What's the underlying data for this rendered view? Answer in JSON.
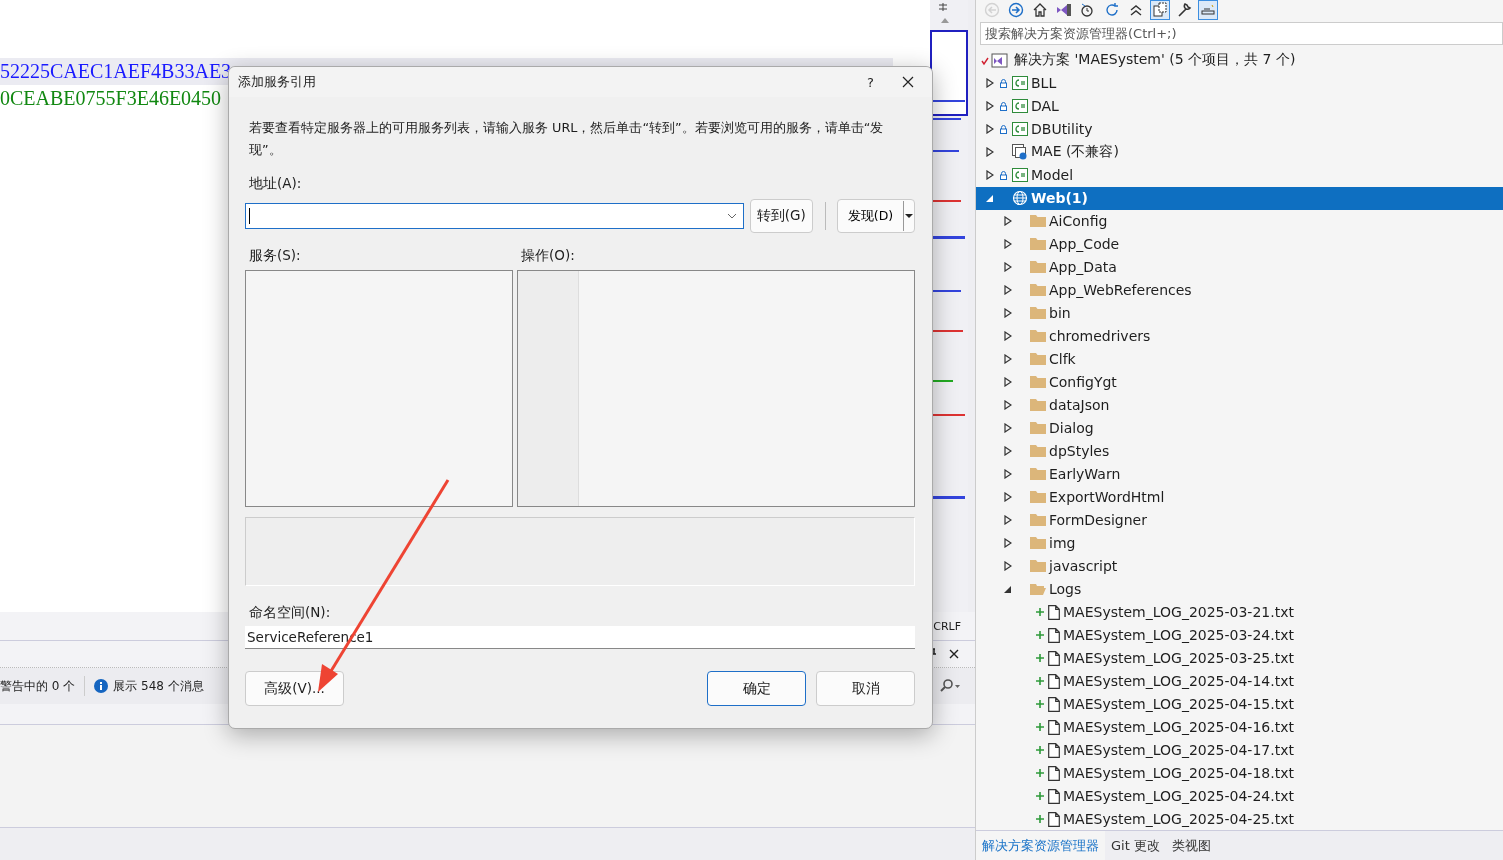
{
  "editor": {
    "code_lines": [
      {
        "text": "52225CAEC1AEF4B33AE3",
        "color": "#1a1aff"
      },
      {
        "text": "0CEABE0755F3E46E0450",
        "color": "#118811"
      }
    ],
    "line_ending": "CRLF"
  },
  "output_panel": {
    "warnings": "警告中的 0 个",
    "messages": "展示 548 个消息"
  },
  "dialog": {
    "title": "添加服务引用",
    "help": "?",
    "description": "若要查看特定服务器上的可用服务列表，请输入服务 URL，然后单击“转到”。若要浏览可用的服务，请单击“发现”。",
    "address_label": "地址(A):",
    "go_button": "转到(G)",
    "discover_button": "发现(D)",
    "services_label": "服务(S):",
    "operations_label": "操作(O):",
    "namespace_label": "命名空间(N):",
    "namespace_value": "ServiceReference1",
    "advanced_button": "高级(V)...",
    "ok_button": "确定",
    "cancel_button": "取消"
  },
  "solution_explorer": {
    "toolbar": [
      {
        "kind": "back",
        "on": false,
        "disabled": true
      },
      {
        "kind": "forward",
        "on": false,
        "disabled": false
      },
      {
        "kind": "home",
        "on": false,
        "disabled": false
      },
      {
        "kind": "switch_views",
        "on": false,
        "disabled": false
      },
      {
        "kind": "history",
        "on": false,
        "disabled": false
      },
      {
        "kind": "refresh",
        "on": false,
        "disabled": false
      },
      {
        "kind": "collapse",
        "on": false,
        "disabled": false
      },
      {
        "kind": "show_all",
        "on": true,
        "disabled": false
      },
      {
        "kind": "properties",
        "on": false,
        "disabled": false
      },
      {
        "kind": "preview",
        "on": true,
        "disabled": false
      }
    ],
    "search": {
      "placeholder": "搜索解决方案资源管理器(Ctrl+;)"
    },
    "tree": [
      {
        "label": "解决方案 'MAESystem' (5 个项目，共 7 个)",
        "kind": "solution",
        "selected": false
      },
      {
        "label": "BLL",
        "kind": "csharp_project",
        "expanded": false,
        "locked": true,
        "startup": false,
        "selected": false
      },
      {
        "label": "DAL",
        "kind": "csharp_project",
        "expanded": false,
        "locked": true,
        "startup": false,
        "selected": false
      },
      {
        "label": "DBUtility",
        "kind": "csharp_project",
        "expanded": false,
        "locked": true,
        "startup": false,
        "selected": false
      },
      {
        "label": "MAE (不兼容)",
        "kind": "unloaded_project",
        "expanded": false,
        "locked": false,
        "startup": false,
        "selected": false
      },
      {
        "label": "Model",
        "kind": "csharp_project",
        "expanded": false,
        "locked": true,
        "startup": false,
        "selected": false
      },
      {
        "label": "Web(1)",
        "kind": "web_project",
        "expanded": true,
        "locked": false,
        "startup": true,
        "selected": true,
        "children": [
          {
            "label": "AiConfig",
            "kind": "folder",
            "expanded": false,
            "selected": false
          },
          {
            "label": "App_Code",
            "kind": "folder",
            "expanded": false,
            "selected": false
          },
          {
            "label": "App_Data",
            "kind": "folder",
            "expanded": false,
            "selected": false
          },
          {
            "label": "App_WebReferences",
            "kind": "folder",
            "expanded": false,
            "selected": false
          },
          {
            "label": "bin",
            "kind": "folder",
            "expanded": false,
            "selected": false
          },
          {
            "label": "chromedrivers",
            "kind": "folder",
            "expanded": false,
            "selected": false
          },
          {
            "label": "Clfk",
            "kind": "folder",
            "expanded": false,
            "selected": false
          },
          {
            "label": "ConfigYgt",
            "kind": "folder",
            "expanded": false,
            "selected": false
          },
          {
            "label": "dataJson",
            "kind": "folder",
            "expanded": false,
            "selected": false
          },
          {
            "label": "Dialog",
            "kind": "folder",
            "expanded": false,
            "selected": false
          },
          {
            "label": "dpStyles",
            "kind": "folder",
            "expanded": false,
            "selected": false
          },
          {
            "label": "EarlyWarn",
            "kind": "folder",
            "expanded": false,
            "selected": false
          },
          {
            "label": "ExportWordHtml",
            "kind": "folder",
            "expanded": false,
            "selected": false
          },
          {
            "label": "FormDesigner",
            "kind": "folder",
            "expanded": false,
            "selected": false
          },
          {
            "label": "img",
            "kind": "folder",
            "expanded": false,
            "selected": false
          },
          {
            "label": "javascript",
            "kind": "folder",
            "expanded": false,
            "selected": false
          },
          {
            "label": "Logs",
            "kind": "folder",
            "expanded": true,
            "selected": false,
            "children": [
              {
                "label": "MAESystem_LOG_2025-03-21.txt",
                "kind": "file",
                "added": true,
                "selected": false
              },
              {
                "label": "MAESystem_LOG_2025-03-24.txt",
                "kind": "file",
                "added": true,
                "selected": false
              },
              {
                "label": "MAESystem_LOG_2025-03-25.txt",
                "kind": "file",
                "added": true,
                "selected": false
              },
              {
                "label": "MAESystem_LOG_2025-04-14.txt",
                "kind": "file",
                "added": true,
                "selected": false
              },
              {
                "label": "MAESystem_LOG_2025-04-15.txt",
                "kind": "file",
                "added": true,
                "selected": false
              },
              {
                "label": "MAESystem_LOG_2025-04-16.txt",
                "kind": "file",
                "added": true,
                "selected": false
              },
              {
                "label": "MAESystem_LOG_2025-04-17.txt",
                "kind": "file",
                "added": true,
                "selected": false
              },
              {
                "label": "MAESystem_LOG_2025-04-18.txt",
                "kind": "file",
                "added": true,
                "selected": false
              },
              {
                "label": "MAESystem_LOG_2025-04-24.txt",
                "kind": "file",
                "added": true,
                "selected": false
              },
              {
                "label": "MAESystem_LOG_2025-04-25.txt",
                "kind": "file",
                "added": true,
                "selected": false
              }
            ]
          }
        ]
      }
    ],
    "tabs": [
      {
        "label": "解决方案资源管理器",
        "selected": true
      },
      {
        "label": "Git 更改",
        "selected": false
      },
      {
        "label": "类视图",
        "selected": false
      }
    ]
  }
}
